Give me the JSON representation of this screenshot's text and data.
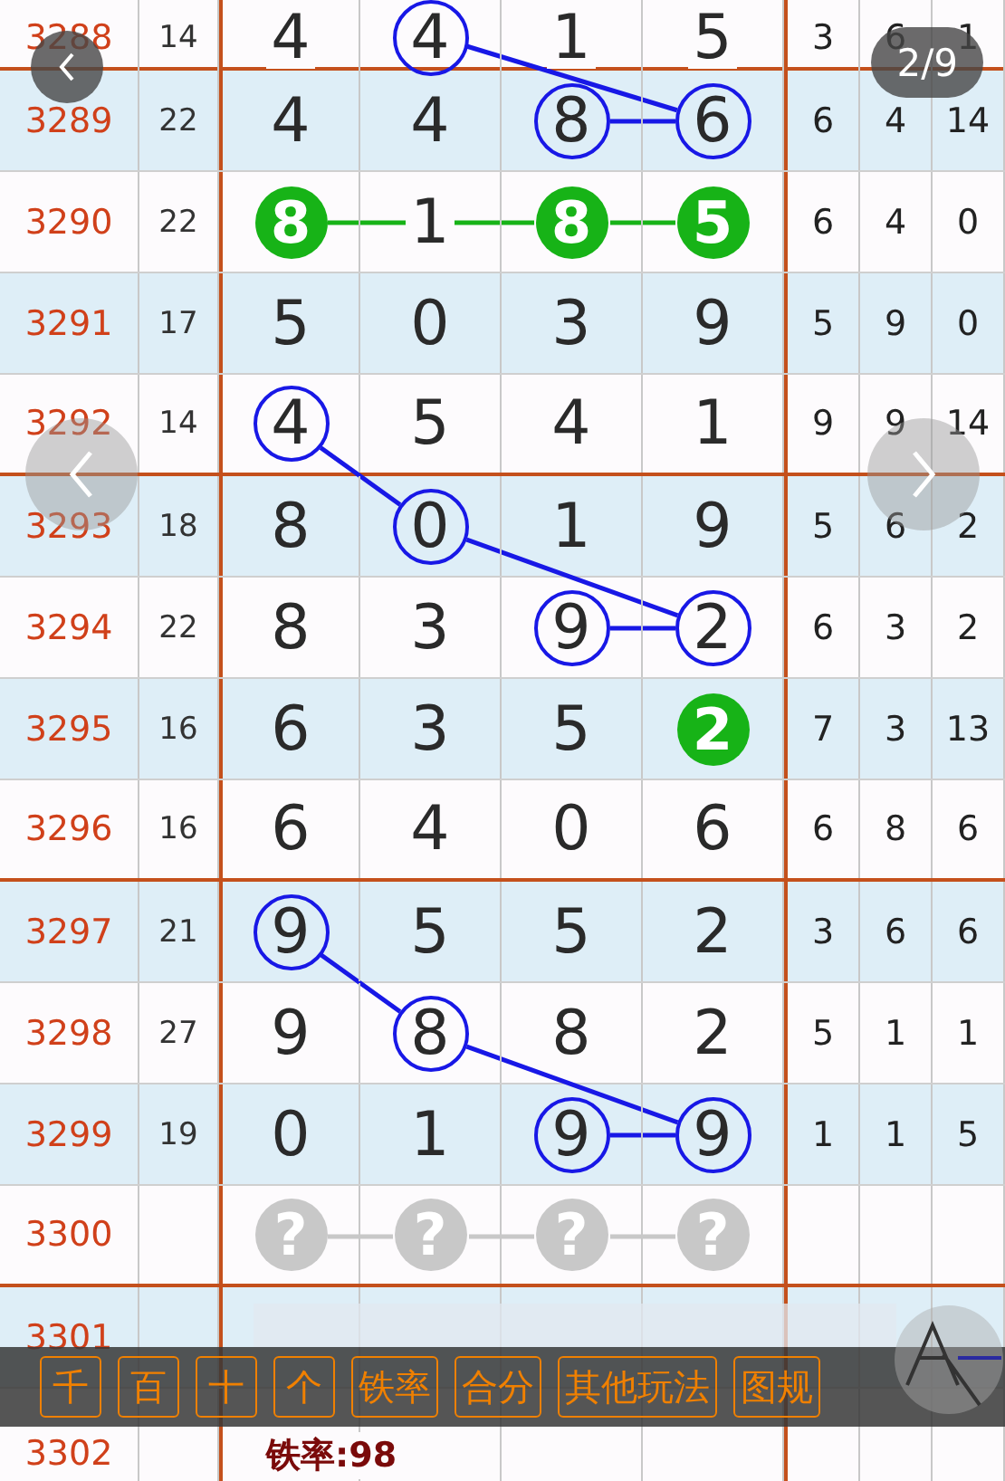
{
  "pager": {
    "label": "2/9"
  },
  "rows": [
    {
      "issue": "3288",
      "sum": "14",
      "digits": [
        {
          "value": "4",
          "circled": false,
          "filled": false
        },
        {
          "value": "4",
          "circled": true,
          "filled": false
        },
        {
          "value": "1",
          "circled": false,
          "filled": false
        },
        {
          "value": "5",
          "circled": false,
          "filled": false
        }
      ],
      "stats": [
        "3",
        "6",
        "1"
      ]
    },
    {
      "issue": "3289",
      "sum": "22",
      "digits": [
        {
          "value": "4",
          "circled": false,
          "filled": false
        },
        {
          "value": "4",
          "circled": false,
          "filled": false
        },
        {
          "value": "8",
          "circled": true,
          "filled": false
        },
        {
          "value": "6",
          "circled": true,
          "filled": false
        }
      ],
      "stats": [
        "6",
        "4",
        "14"
      ]
    },
    {
      "issue": "3290",
      "sum": "22",
      "digits": [
        {
          "value": "8",
          "circled": false,
          "filled": true,
          "color": "#17b317"
        },
        {
          "value": "1",
          "circled": false,
          "filled": false
        },
        {
          "value": "8",
          "circled": false,
          "filled": true,
          "color": "#17b317"
        },
        {
          "value": "5",
          "circled": false,
          "filled": true,
          "color": "#17b317"
        }
      ],
      "stats": [
        "6",
        "4",
        "0"
      ]
    },
    {
      "issue": "3291",
      "sum": "17",
      "digits": [
        {
          "value": "5",
          "circled": false,
          "filled": false
        },
        {
          "value": "0",
          "circled": false,
          "filled": false
        },
        {
          "value": "3",
          "circled": false,
          "filled": false
        },
        {
          "value": "9",
          "circled": false,
          "filled": false
        }
      ],
      "stats": [
        "5",
        "9",
        "0"
      ]
    },
    {
      "issue": "3292",
      "sum": "14",
      "digits": [
        {
          "value": "4",
          "circled": true,
          "filled": false
        },
        {
          "value": "5",
          "circled": false,
          "filled": false
        },
        {
          "value": "4",
          "circled": false,
          "filled": false
        },
        {
          "value": "1",
          "circled": false,
          "filled": false
        }
      ],
      "stats": [
        "9",
        "9",
        "14"
      ]
    },
    {
      "issue": "3293",
      "sum": "18",
      "digits": [
        {
          "value": "8",
          "circled": false,
          "filled": false
        },
        {
          "value": "0",
          "circled": true,
          "filled": false
        },
        {
          "value": "1",
          "circled": false,
          "filled": false
        },
        {
          "value": "9",
          "circled": false,
          "filled": false
        }
      ],
      "stats": [
        "5",
        "6",
        "2"
      ]
    },
    {
      "issue": "3294",
      "sum": "22",
      "digits": [
        {
          "value": "8",
          "circled": false,
          "filled": false
        },
        {
          "value": "3",
          "circled": false,
          "filled": false
        },
        {
          "value": "9",
          "circled": true,
          "filled": false
        },
        {
          "value": "2",
          "circled": true,
          "filled": false
        }
      ],
      "stats": [
        "6",
        "3",
        "2"
      ]
    },
    {
      "issue": "3295",
      "sum": "16",
      "digits": [
        {
          "value": "6",
          "circled": false,
          "filled": false
        },
        {
          "value": "3",
          "circled": false,
          "filled": false
        },
        {
          "value": "5",
          "circled": false,
          "filled": false
        },
        {
          "value": "2",
          "circled": false,
          "filled": true,
          "color": "#17b317"
        }
      ],
      "stats": [
        "7",
        "3",
        "13"
      ]
    },
    {
      "issue": "3296",
      "sum": "16",
      "digits": [
        {
          "value": "6",
          "circled": false,
          "filled": false
        },
        {
          "value": "4",
          "circled": false,
          "filled": false
        },
        {
          "value": "0",
          "circled": false,
          "filled": false
        },
        {
          "value": "6",
          "circled": false,
          "filled": false
        }
      ],
      "stats": [
        "6",
        "8",
        "6"
      ]
    },
    {
      "issue": "3297",
      "sum": "21",
      "digits": [
        {
          "value": "9",
          "circled": true,
          "filled": false
        },
        {
          "value": "5",
          "circled": false,
          "filled": false
        },
        {
          "value": "5",
          "circled": false,
          "filled": false
        },
        {
          "value": "2",
          "circled": false,
          "filled": false
        }
      ],
      "stats": [
        "3",
        "6",
        "6"
      ]
    },
    {
      "issue": "3298",
      "sum": "27",
      "digits": [
        {
          "value": "9",
          "circled": false,
          "filled": false
        },
        {
          "value": "8",
          "circled": true,
          "filled": false
        },
        {
          "value": "8",
          "circled": false,
          "filled": false
        },
        {
          "value": "2",
          "circled": false,
          "filled": false
        }
      ],
      "stats": [
        "5",
        "1",
        "1"
      ]
    },
    {
      "issue": "3299",
      "sum": "19",
      "digits": [
        {
          "value": "0",
          "circled": false,
          "filled": false
        },
        {
          "value": "1",
          "circled": false,
          "filled": false
        },
        {
          "value": "9",
          "circled": true,
          "filled": false
        },
        {
          "value": "9",
          "circled": true,
          "filled": false
        }
      ],
      "stats": [
        "1",
        "1",
        "5"
      ]
    },
    {
      "issue": "3300",
      "digits": [
        {
          "value": "?",
          "circled": false,
          "filled": true,
          "color": "#c8c8c8"
        },
        {
          "value": "?",
          "circled": false,
          "filled": true,
          "color": "#c8c8c8"
        },
        {
          "value": "?",
          "circled": false,
          "filled": true,
          "color": "#c8c8c8"
        },
        {
          "value": "?",
          "circled": false,
          "filled": true,
          "color": "#c8c8c8"
        }
      ]
    },
    {
      "issue": "3301"
    },
    {
      "issue": "3302"
    }
  ],
  "rate_note": "铁率:98",
  "toolbar": {
    "buttons": [
      "千",
      "百",
      "十",
      "个",
      "铁率",
      "合分",
      "其他玩法",
      "图规"
    ]
  }
}
